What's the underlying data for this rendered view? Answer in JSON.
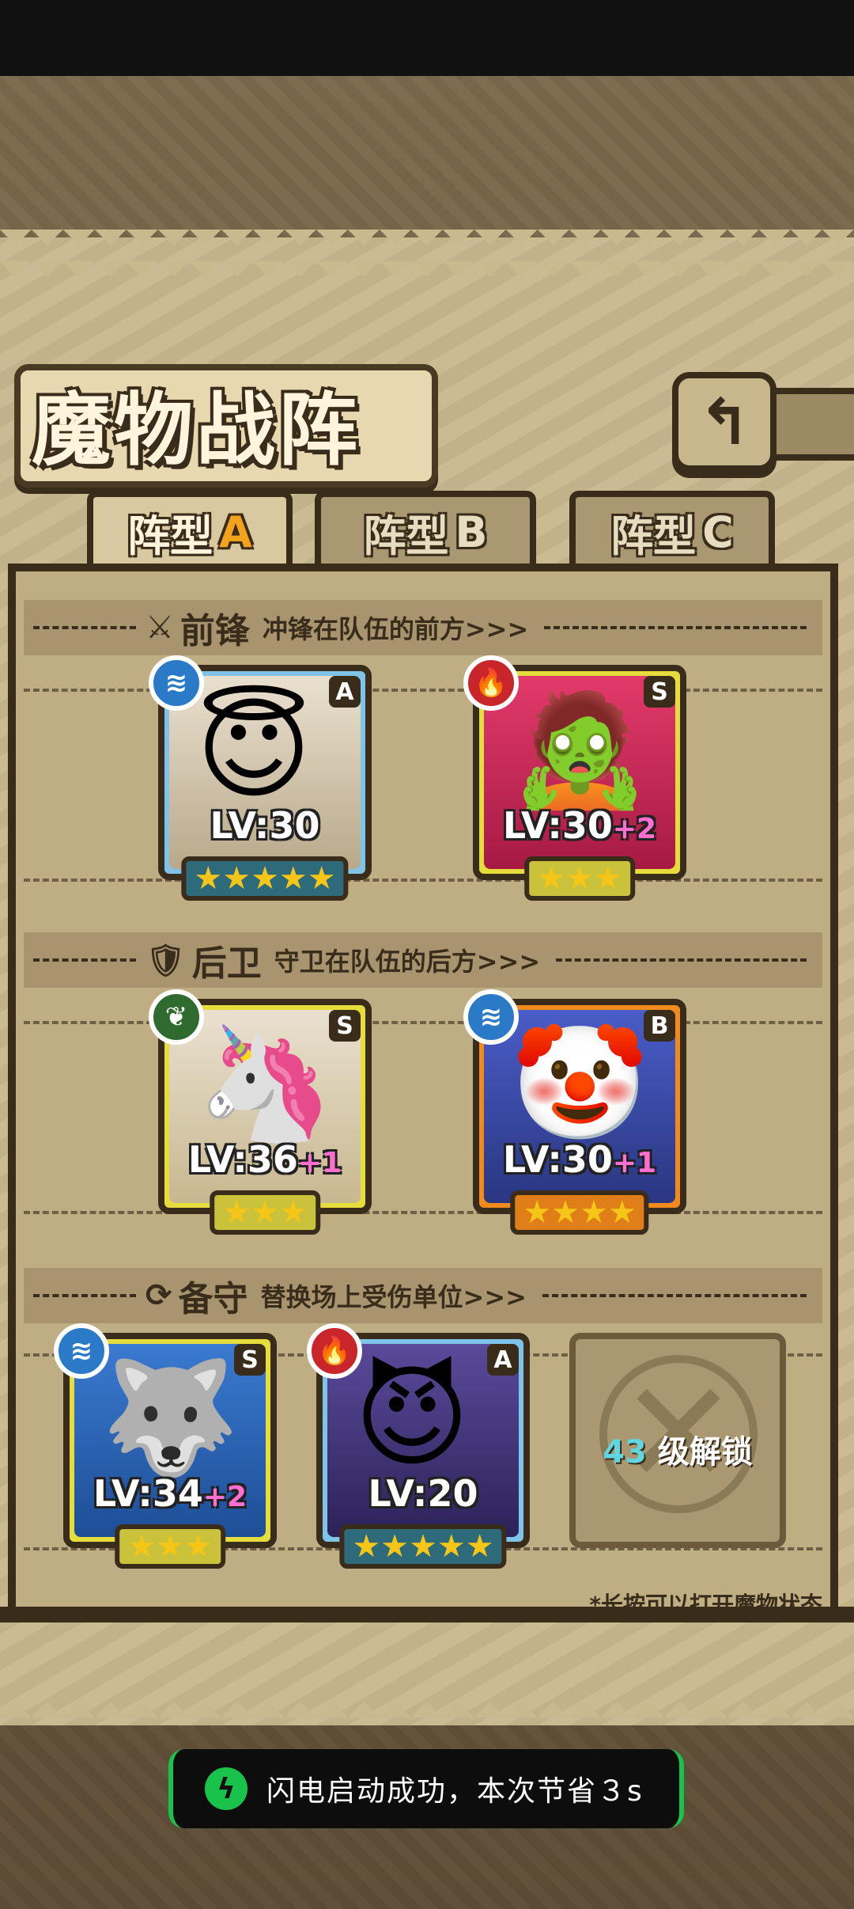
{
  "page": {
    "title": "魔物战阵",
    "back_icon": "back-arrow-icon"
  },
  "tabs": [
    {
      "label": "阵型",
      "letter": "A",
      "active": true
    },
    {
      "label": "阵型",
      "letter": "B",
      "active": false
    },
    {
      "label": "阵型",
      "letter": "C",
      "active": false
    }
  ],
  "sections": {
    "front": {
      "title": "前锋",
      "subtitle": "冲锋在队伍的前方>>>",
      "icon": "sword-icon"
    },
    "back": {
      "title": "后卫",
      "subtitle": "守卫在队伍的后方>>>",
      "icon": "shield-icon"
    },
    "reserve": {
      "title": "备守",
      "subtitle": "替换场上受伤单位>>>",
      "icon": "swap-icon"
    }
  },
  "monsters": {
    "front1": {
      "lv": "LV:30",
      "plus": "",
      "rank": "A",
      "element": "water",
      "stars": "★★★★★"
    },
    "front2": {
      "lv": "LV:30",
      "plus": "+2",
      "rank": "S",
      "element": "fire",
      "stars": "★★★"
    },
    "back1": {
      "lv": "LV:36",
      "plus": "+1",
      "rank": "S",
      "element": "grass",
      "stars": "★★★"
    },
    "back2": {
      "lv": "LV:30",
      "plus": "+1",
      "rank": "B",
      "element": "water",
      "stars": "★★★★"
    },
    "reserve1": {
      "lv": "LV:34",
      "plus": "+2",
      "rank": "S",
      "element": "water",
      "stars": "★★★"
    },
    "reserve2": {
      "lv": "LV:20",
      "plus": "",
      "rank": "A",
      "element": "fire",
      "stars": "★★★★★"
    }
  },
  "locked_slot": {
    "level": "43",
    "text": "级解锁"
  },
  "hint": "*长按可以打开魔物状态",
  "toast": {
    "message": "闪电启动成功，本次节省３s"
  },
  "colors": {
    "accent_orange": "#f2a21c",
    "toast_green": "#19c24a"
  }
}
